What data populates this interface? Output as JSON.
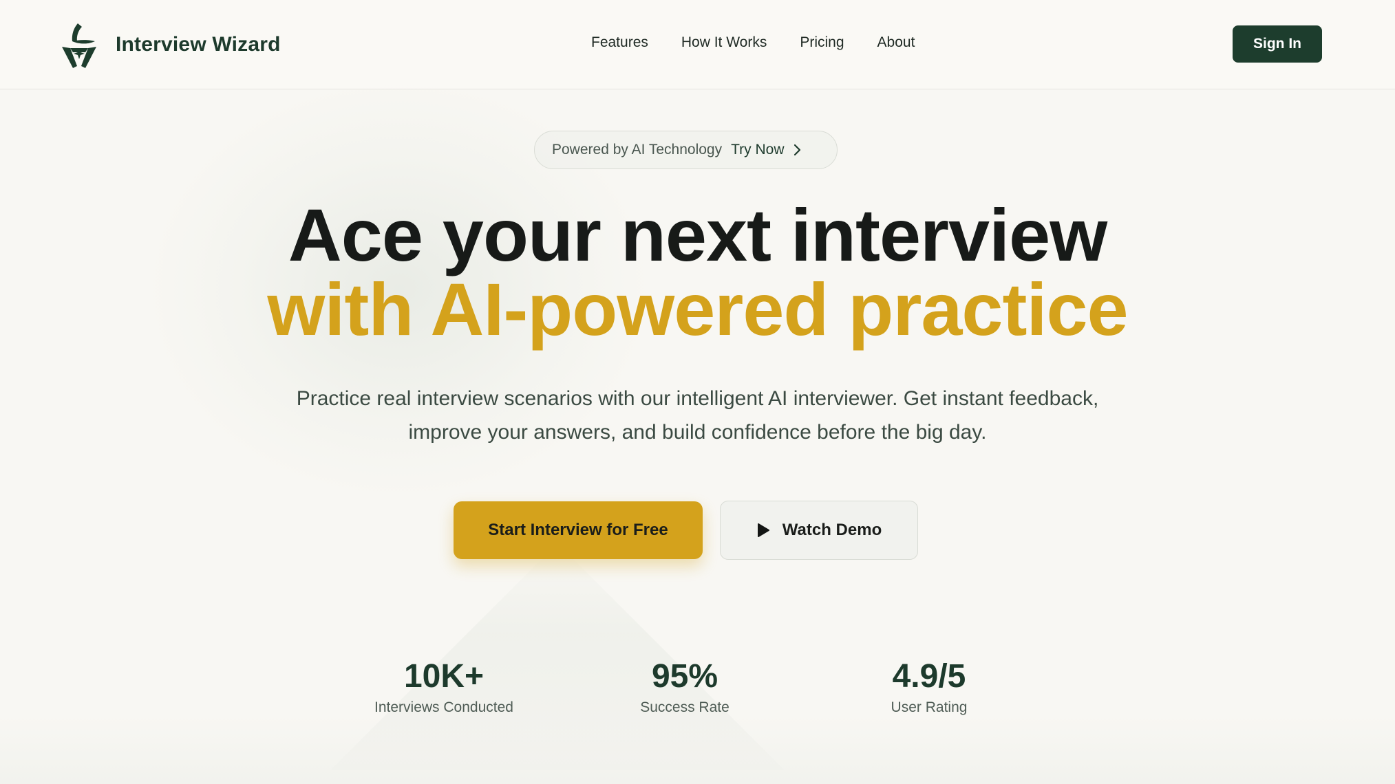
{
  "header": {
    "brand_name": "Interview Wizard",
    "nav": [
      "Features",
      "How It Works",
      "Pricing",
      "About"
    ],
    "sign_in_label": "Sign In"
  },
  "hero": {
    "badge": {
      "text": "Powered by AI Technology",
      "link": "Try Now"
    },
    "headline_line1": "Ace your next interview",
    "headline_line2": "with AI-powered practice",
    "subtitle": "Practice real interview scenarios with our intelligent AI interviewer. Get instant feedback, improve your answers, and build confidence before the big day.",
    "primary_cta": "Start Interview for Free",
    "secondary_cta": "Watch Demo"
  },
  "stats": [
    {
      "value": "10K+",
      "label": "Interviews Conducted"
    },
    {
      "value": "95%",
      "label": "Success Rate"
    },
    {
      "value": "4.9/5",
      "label": "User Rating"
    }
  ],
  "colors": {
    "brand_green": "#1d3d2d",
    "accent_gold": "#d4a21c",
    "background": "#f8f7f3"
  },
  "icons": {
    "logo": "wizard-hat-logo-icon",
    "badge_arrow": "chevron-right-icon",
    "demo": "play-icon"
  }
}
